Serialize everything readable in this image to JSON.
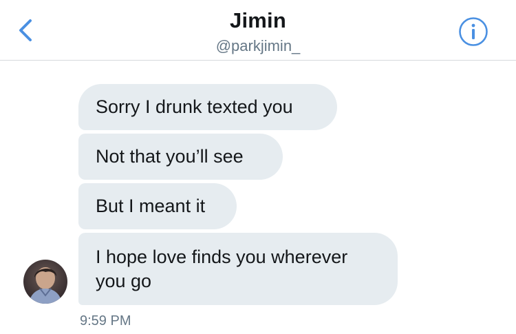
{
  "header": {
    "name": "Jimin",
    "handle": "@parkjimin_",
    "back_icon": "chevron-left-icon",
    "info_icon": "info-icon",
    "accent_color": "#4a90e2"
  },
  "messages": [
    {
      "text": "Sorry I drunk texted you"
    },
    {
      "text": "Not that you’ll see"
    },
    {
      "text": "But I meant it"
    },
    {
      "text": "I hope love finds you wherever you go"
    }
  ],
  "timestamp": "9:59 PM",
  "colors": {
    "bubble_bg": "#e6ecf0",
    "text": "#14171a",
    "secondary_text": "#657786"
  }
}
